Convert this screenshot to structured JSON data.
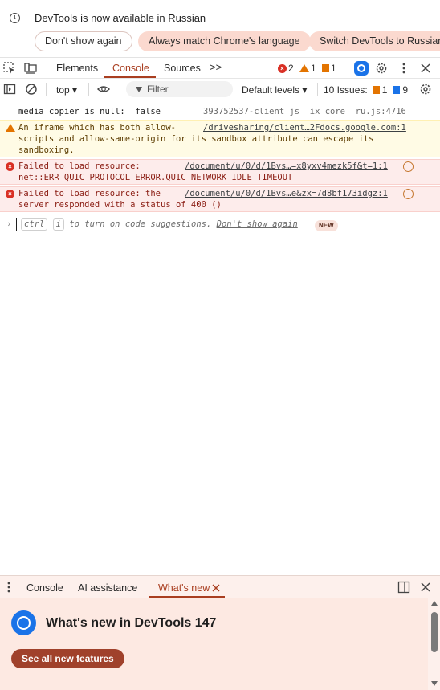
{
  "infobar": {
    "icon": "info-icon",
    "message": "DevTools is now available in Russian",
    "buttons": [
      "Don't show again",
      "Always match Chrome's language",
      "Switch DevTools to Russian"
    ]
  },
  "toolbar": {
    "tabs": [
      "Elements",
      "Console",
      "Sources"
    ],
    "active_tab": "Console",
    "more_tabs": ">>",
    "errors": "2",
    "warnings": "1",
    "issues": "1"
  },
  "console_bar": {
    "context": "top ▾",
    "filter_placeholder": "Filter",
    "levels": "Default levels ▾",
    "issues_label": "10 Issues:",
    "issues_orange": "1",
    "issues_blue": "9"
  },
  "messages": [
    {
      "level": "log",
      "lines": [
        "media copier is null:  false"
      ],
      "source": "393752537-client_js__ix_core__ru.js:4716"
    },
    {
      "level": "warning",
      "lines": [
        "An iframe which has both allow-",
        "scripts and allow-same-origin for its sandbox attribute can escape its",
        "sandboxing."
      ],
      "source": "/drivesharing/client…2Fdocs.google.com:1"
    },
    {
      "level": "error",
      "lines": [
        "Failed to load resource:",
        "net::ERR_QUIC_PROTOCOL_ERROR.QUIC_NETWORK_IDLE_TIMEOUT"
      ],
      "source": "/document/u/0/d/1Bvs…=x8yxv4mezk5f&t=1:1"
    },
    {
      "level": "error",
      "lines": [
        "Failed to load resource: the",
        "server responded with a status of 400 ()"
      ],
      "source": "/document/u/0/d/1Bvs…e&zx=7d8bf173idgz:1"
    }
  ],
  "prompt": {
    "key1": "ctrl",
    "key2": "i",
    "hint": "to turn on code suggestions.",
    "dismiss": "Don't show again",
    "badge": "NEW"
  },
  "drawer": {
    "tabs": [
      "Console",
      "AI assistance",
      "What's new"
    ],
    "active_tab": "What's new",
    "title": "What's new in DevTools 147",
    "cta": "See all new features"
  },
  "colors": {
    "accent": "#a93e20",
    "error": "#d93025",
    "warning": "#e37400",
    "drawer_bg": "#fde9e2"
  }
}
